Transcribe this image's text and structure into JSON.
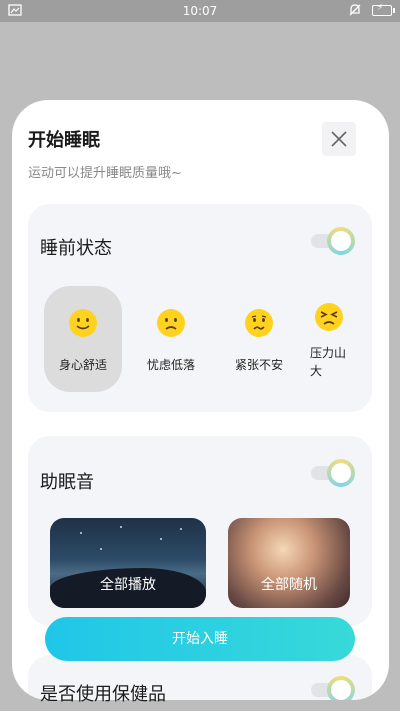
{
  "status_bar": {
    "time": "10:07"
  },
  "sheet": {
    "title": "开始睡眠",
    "subtitle": "运动可以提升睡眠质量哦~"
  },
  "pre_sleep": {
    "title": "睡前状态",
    "toggle_on": true,
    "moods": [
      {
        "label": "身心舒适",
        "icon": "smile-face-icon",
        "selected": true
      },
      {
        "label": "忧虑低落",
        "icon": "sad-face-icon",
        "selected": false
      },
      {
        "label": "紧张不安",
        "icon": "worried-face-icon",
        "selected": false
      },
      {
        "label": "压力山",
        "label2": "大",
        "icon": "stressed-face-icon",
        "selected": false
      }
    ]
  },
  "sleep_sound": {
    "title": "助眠音",
    "toggle_on": true,
    "tiles": [
      {
        "label": "全部播放"
      },
      {
        "label": "全部随机"
      }
    ]
  },
  "start_button": {
    "label": "开始入睡"
  },
  "third_card": {
    "title": "是否使用保健品"
  },
  "colors": {
    "accent": "#20c6e8",
    "emoji": "#ffd21f"
  }
}
